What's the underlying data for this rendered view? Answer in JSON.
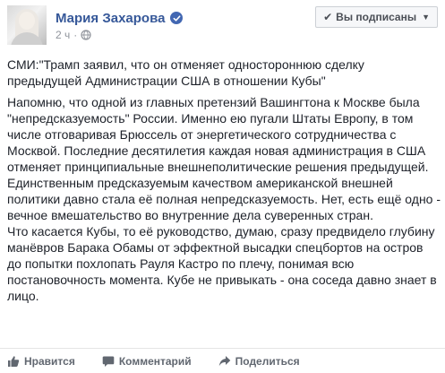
{
  "post": {
    "author": "Мария Захарова",
    "time": "2 ч",
    "separator": "·",
    "subscribe_label": "Вы подписаны",
    "lead": "СМИ:\"Трамп заявил, что он отменяет одностороннюю сделку предыдущей Администрации США в отношении Кубы\"",
    "paragraph_1": "Напомню, что одной из главных претензий Вашингтона к Москве была \"непредсказуемость\" России. Именно ею пугали Штаты Европу, в том числе отговаривая Брюссель от энергетического сотрудничества с Москвой. Последние десятилетия каждая новая администрация в США отменяет принципиальные внешнеполитические решения предыдущей. Единственным предсказуемым качеством американской внешней политики давно стала её полная непредсказуемость. Нет, есть ещё одно - вечное вмешательство во внутренние дела суверенных стран.",
    "paragraph_2": "Что касается Кубы, то её руководство, думаю, сразу предвидело глубину манёвров Барака Обамы от эффектной высадки спецбортов на остров до попытки похлопать Рауля Кастро по плечу, понимая всю постановочность момента. Кубе не привыкать - она соседа давно знает в лицо."
  },
  "actions": {
    "like": "Нравится",
    "comment": "Комментарий",
    "share": "Поделиться"
  },
  "colors": {
    "author": "#365899",
    "verified_badge": "#4267b2",
    "meta": "#90949c",
    "action_text": "#616770"
  },
  "icons": [
    "verified-icon",
    "globe-icon",
    "check-icon",
    "caret-down-icon",
    "like-icon",
    "comment-icon",
    "share-icon"
  ]
}
